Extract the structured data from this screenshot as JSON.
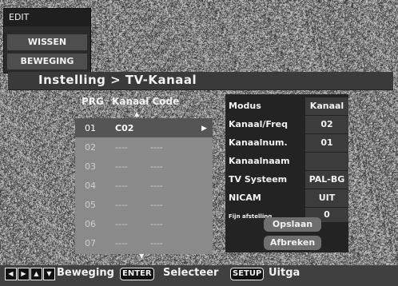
{
  "edit_menu": {
    "title": "EDIT",
    "items": [
      {
        "label": "WISSEN"
      },
      {
        "label": "BEWEGING"
      }
    ]
  },
  "header": {
    "title": "Instelling > TV-Kanaal"
  },
  "channel_list": {
    "columns": {
      "prg": "PRG",
      "code": "Kanaal Code"
    },
    "rows": [
      {
        "prg": "01",
        "code": "C02",
        "extra": "",
        "selected": true
      },
      {
        "prg": "02",
        "code": "----",
        "extra": "----",
        "selected": false
      },
      {
        "prg": "03",
        "code": "----",
        "extra": "----",
        "selected": false
      },
      {
        "prg": "04",
        "code": "----",
        "extra": "----",
        "selected": false
      },
      {
        "prg": "05",
        "code": "----",
        "extra": "----",
        "selected": false
      },
      {
        "prg": "06",
        "code": "----",
        "extra": "----",
        "selected": false
      },
      {
        "prg": "07",
        "code": "----",
        "extra": "----",
        "selected": false
      }
    ],
    "up_arrow": "▲",
    "down_arrow": "▼",
    "row_arrow": "▶"
  },
  "settings": {
    "rows": [
      {
        "label": "Modus",
        "value": "Kanaal"
      },
      {
        "label": "Kanaal/Freq",
        "value": "02"
      },
      {
        "label": "Kanaalnum.",
        "value": "01"
      },
      {
        "label": "Kanaalnaam",
        "value": ""
      },
      {
        "label": "TV Systeem",
        "value": "PAL-BG"
      },
      {
        "label": "NICAM",
        "value": "UIT"
      },
      {
        "label": "Fijn afstelling",
        "value": "0"
      }
    ],
    "save_label": "Opslaan",
    "cancel_label": "Afbreken"
  },
  "footer": {
    "arrow_icons": [
      "◀",
      "▶",
      "▲",
      "▼"
    ],
    "move_label": "Beweging",
    "enter_key": "ENTER",
    "select_label": "Selecteer",
    "setup_key": "SETUP",
    "exit_label": "Uitga"
  }
}
